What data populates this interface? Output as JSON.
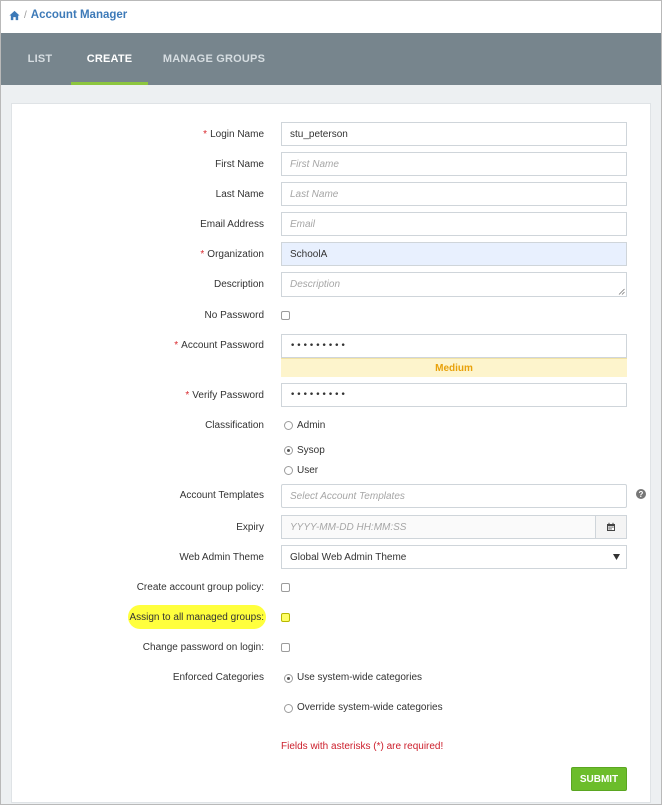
{
  "breadcrumb": {
    "home_icon": "home-icon",
    "separator": "/",
    "current": "Account Manager"
  },
  "tabs": [
    {
      "label": "LIST",
      "active": false
    },
    {
      "label": "CREATE",
      "active": true
    },
    {
      "label": "MANAGE GROUPS",
      "active": false
    }
  ],
  "form": {
    "required_marker": "*",
    "login_name": {
      "label": "Login Name",
      "value": "stu_peterson"
    },
    "first_name": {
      "label": "First Name",
      "placeholder": "First Name"
    },
    "last_name": {
      "label": "Last Name",
      "placeholder": "Last Name"
    },
    "email": {
      "label": "Email Address",
      "placeholder": "Email"
    },
    "organization": {
      "label": "Organization",
      "value": "SchoolA"
    },
    "description": {
      "label": "Description",
      "placeholder": "Description"
    },
    "no_password": {
      "label": "No Password"
    },
    "account_password": {
      "label": "Account Password",
      "value": "•••••••••",
      "strength": "Medium"
    },
    "verify_password": {
      "label": "Verify Password",
      "value": "•••••••••"
    },
    "classification": {
      "label": "Classification",
      "options": [
        {
          "label": "Admin",
          "checked": false
        },
        {
          "label": "Sysop",
          "checked": true
        },
        {
          "label": "User",
          "checked": false
        }
      ]
    },
    "account_templates": {
      "label": "Account Templates",
      "placeholder": "Select Account Templates",
      "help_icon": "question-circle-icon"
    },
    "expiry": {
      "label": "Expiry",
      "placeholder": "YYYY-MM-DD HH:MM:SS",
      "icon": "calendar-icon"
    },
    "web_admin_theme": {
      "label": "Web Admin Theme",
      "value": "Global Web Admin Theme"
    },
    "create_group_policy": {
      "label": "Create account group policy:"
    },
    "assign_all_groups": {
      "label": "Assign to all managed groups:"
    },
    "change_password": {
      "label": "Change password on login:"
    },
    "enforced_categories": {
      "label": "Enforced Categories",
      "options": [
        {
          "label": "Use system-wide categories",
          "checked": true
        },
        {
          "label": "Override system-wide categories",
          "checked": false
        }
      ]
    },
    "required_note": "Fields with asterisks (*) are required!",
    "submit_label": "SUBMIT"
  },
  "colors": {
    "tabbar": "#77858d",
    "active_tab_underline": "#8dc63f",
    "submit": "#6cbd2b",
    "strength_text": "#e8a10b",
    "required": "#d9282d",
    "link": "#3d7ab8",
    "highlight": "#ffff33"
  }
}
